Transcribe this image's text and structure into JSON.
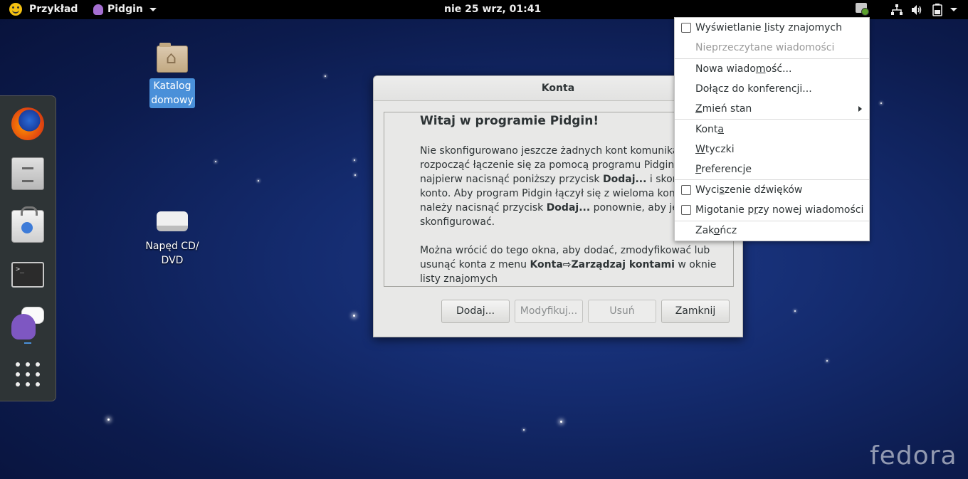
{
  "topbar": {
    "app_name": "Przykład",
    "app_menu": "Pidgin",
    "clock": "nie 25 wrz, 01:41"
  },
  "desktop": {
    "home_label": [
      "Katalog",
      "domowy"
    ],
    "cd_label": [
      "Napęd CD/",
      "DVD"
    ],
    "watermark": "fedora"
  },
  "dock": {
    "apps": [
      "firefox-icon",
      "file-cabinet-icon",
      "software-bag-icon",
      "terminal-icon",
      "pidgin-icon",
      "app-grid-icon"
    ]
  },
  "dialog": {
    "title": "Konta",
    "welcome": "Witaj w programie Pidgin!",
    "para1": [
      "Nie skonfigurowano jeszcze żadnych kont komunikatora.",
      "rozpocząć łączenie się za pomocą programu Pidgin, nale",
      "najpierw nacisnąć poniższy przycisk ",
      "Dodaj...",
      " i skonfiguro",
      "konto. Aby program Pidgin łączył się z wieloma kontami,",
      "należy nacisnąć przycisk ",
      "Dodaj...",
      " ponownie, aby je",
      "skonfigurować."
    ],
    "para2": [
      "Można wrócić do tego okna, aby dodać, zmodyfikować lub",
      "usunąć konta z menu ",
      "Konta⇨Zarządzaj kontami",
      " w oknie",
      "listy znajomych"
    ],
    "buttons": {
      "add": "Dodaj...",
      "modify": "Modyfikuj...",
      "delete": "Usuń",
      "close": "Zamknij"
    }
  },
  "menu": {
    "show_buddy_list": [
      "Wyświetlanie ",
      "l",
      "isty znajomych"
    ],
    "unread": "Nieprzeczytane wiadomości",
    "new_message": [
      "Nowa wiado",
      "m",
      "ość..."
    ],
    "join_chat": "Dołącz do konferencji...",
    "change_status": [
      "",
      "Z",
      "mień stan"
    ],
    "accounts": [
      "Kont",
      "a",
      ""
    ],
    "plugins": [
      "",
      "W",
      "tyczki"
    ],
    "preferences": [
      "",
      "P",
      "referencje"
    ],
    "mute_sounds": [
      "Wyci",
      "s",
      "zenie dźwięków"
    ],
    "blink": [
      "Migotanie p",
      "r",
      "zy nowej wiadomości"
    ],
    "quit": [
      "Zak",
      "o",
      "ńcz"
    ]
  }
}
